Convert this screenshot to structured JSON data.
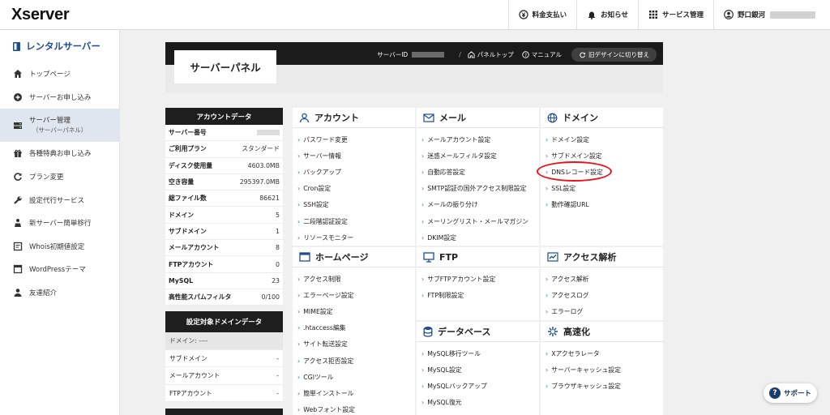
{
  "header": {
    "logo": "Xserver",
    "nav": [
      {
        "icon": "yen-coin-icon",
        "label": "料金支払い"
      },
      {
        "icon": "bell-icon",
        "label": "お知らせ"
      },
      {
        "icon": "grid-icon",
        "label": "サービス管理"
      },
      {
        "icon": "user-icon",
        "label": "野口銀河"
      }
    ]
  },
  "sidebar": {
    "title": "レンタルサーバー",
    "items": [
      {
        "icon": "home-icon",
        "label": "トップページ"
      },
      {
        "icon": "plus-circle-icon",
        "label": "サーバーお申し込み"
      },
      {
        "icon": "server-icon",
        "label": "サーバー管理",
        "sub": "（サーバーパネル）"
      },
      {
        "icon": "gift-icon",
        "label": "各種特典お申し込み"
      },
      {
        "icon": "refresh-icon",
        "label": "プラン変更"
      },
      {
        "icon": "wrench-icon",
        "label": "設定代行サービス"
      },
      {
        "icon": "migrate-icon",
        "label": "新サーバー簡単移行"
      },
      {
        "icon": "form-icon",
        "label": "Whois初期値設定"
      },
      {
        "icon": "browser-icon",
        "label": "WordPressテーマ"
      },
      {
        "icon": "person-icon",
        "label": "友達紹介"
      }
    ]
  },
  "banner": {
    "title": "サーバーパネル",
    "server_id_label": "サーバーID",
    "panel_top": "パネルトップ",
    "manual": "マニュアル",
    "old_design": "旧デザインに切り替え"
  },
  "account": {
    "heading": "アカウントデータ",
    "rows": [
      {
        "label": "サーバー番号",
        "value": ""
      },
      {
        "label": "ご利用プラン",
        "value": "スタンダード"
      },
      {
        "label": "ディスク使用量",
        "value": "4603.0MB"
      },
      {
        "label": "空き容量",
        "value": "295397.0MB"
      },
      {
        "label": "総ファイル数",
        "value": "86621"
      },
      {
        "label": "ドメイン",
        "value": "5"
      },
      {
        "label": "サブドメイン",
        "value": "1"
      },
      {
        "label": "メールアカウント",
        "value": "8"
      },
      {
        "label": "FTPアカウント",
        "value": "0"
      },
      {
        "label": "MySQL",
        "value": "23"
      },
      {
        "label": "高性能スパムフィルタ",
        "value": "0/100"
      }
    ],
    "domain_heading": "設定対象ドメインデータ",
    "domain_rows": [
      {
        "label": "ドメイン: ----",
        "value": ""
      },
      {
        "label": "サブドメイン",
        "value": "-"
      },
      {
        "label": "メールアカウント",
        "value": "-"
      },
      {
        "label": "FTPアカウント",
        "value": "-"
      }
    ]
  },
  "sections": {
    "account": {
      "title": "アカウント",
      "icon": "user-outline-icon",
      "links": [
        "パスワード変更",
        "サーバー情報",
        "バックアップ",
        "Cron設定",
        "SSH設定",
        "二段階認証設定",
        "リソースモニター"
      ]
    },
    "mail": {
      "title": "メール",
      "icon": "envelope-icon",
      "links": [
        "メールアカウント設定",
        "迷惑メールフィルタ設定",
        "自動応答設定",
        "SMTP認証の国外アクセス制限設定",
        "メールの振り分け",
        "メーリングリスト・メールマガジン",
        "DKIM設定"
      ]
    },
    "domain": {
      "title": "ドメイン",
      "icon": "globe-icon",
      "links": [
        "ドメイン設定",
        "サブドメイン設定",
        "DNSレコード設定",
        "SSL設定",
        "動作確認URL"
      ]
    },
    "homepage": {
      "title": "ホームページ",
      "icon": "window-icon",
      "links": [
        "アクセス制限",
        "エラーページ設定",
        "MIME設定",
        ".htaccess編集",
        "サイト転送設定",
        "アクセス拒否設定",
        "CGIツール",
        "簡単インストール",
        "Webフォント設定"
      ]
    },
    "ftp": {
      "title": "FTP",
      "icon": "monitor-icon",
      "links": [
        "サブFTPアカウント設定",
        "FTP制限設定"
      ]
    },
    "analytics": {
      "title": "アクセス解析",
      "icon": "chart-icon",
      "links": [
        "アクセス解析",
        "アクセスログ",
        "エラーログ"
      ]
    },
    "database": {
      "title": "データベース",
      "icon": "database-icon",
      "links": [
        "MySQL移行ツール",
        "MySQL設定",
        "MySQLバックアップ",
        "MySQL復元"
      ]
    },
    "speed": {
      "title": "高速化",
      "icon": "speed-icon",
      "links": [
        "Xアクセラレータ",
        "サーバーキャッシュ設定",
        "ブラウザキャッシュ設定"
      ]
    }
  },
  "support": {
    "label": "サポート"
  },
  "colors": {
    "brand_blue": "#1b4c94",
    "link_chevron": "#3a6db5",
    "highlight_red": "#e8141b",
    "dark_header": "#1e1e1e"
  }
}
